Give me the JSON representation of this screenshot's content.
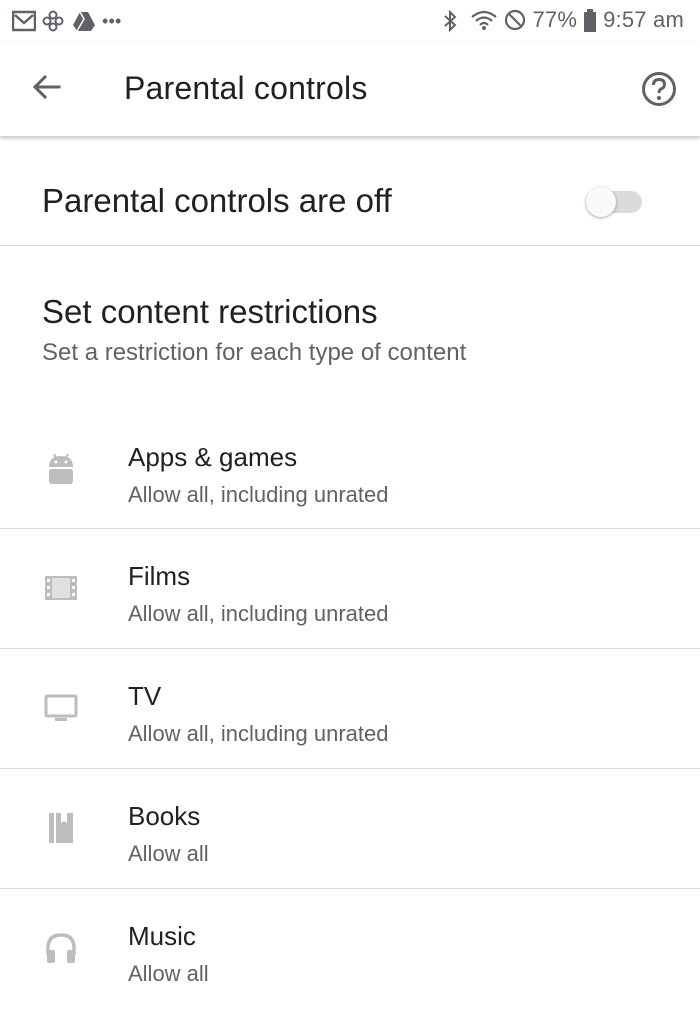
{
  "status_bar": {
    "battery": "77%",
    "time": "9:57 am",
    "overflow": "•••"
  },
  "app_bar": {
    "title": "Parental controls"
  },
  "master": {
    "label": "Parental controls are off",
    "toggle_on": false
  },
  "section": {
    "title": "Set content restrictions",
    "subtitle": "Set a restriction for each type of content"
  },
  "items": [
    {
      "title": "Apps & games",
      "subtitle": "Allow all, including unrated",
      "icon": "android-icon"
    },
    {
      "title": "Films",
      "subtitle": "Allow all, including unrated",
      "icon": "film-icon"
    },
    {
      "title": "TV",
      "subtitle": "Allow all, including unrated",
      "icon": "tv-icon"
    },
    {
      "title": "Books",
      "subtitle": "Allow all",
      "icon": "book-icon"
    },
    {
      "title": "Music",
      "subtitle": "Allow all",
      "icon": "headphones-icon"
    }
  ],
  "colors": {
    "icon_gray": "#bdbdbd",
    "text_primary": "#202124",
    "text_secondary": "#5f6368",
    "divider": "#dadce0"
  }
}
